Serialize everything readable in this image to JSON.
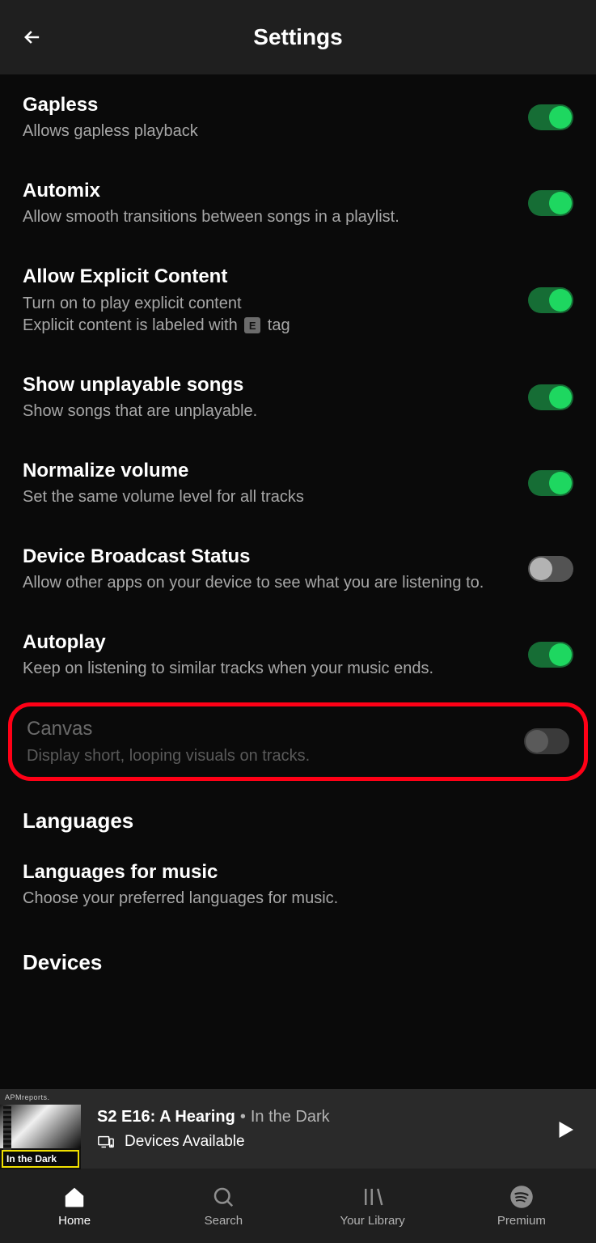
{
  "header": {
    "title": "Settings"
  },
  "settings": [
    {
      "title": "Gapless",
      "desc": "Allows gapless playback",
      "on": true,
      "name": "gapless"
    },
    {
      "title": "Automix",
      "desc": "Allow smooth transitions between songs in a playlist.",
      "on": true,
      "name": "automix"
    },
    {
      "title": "Allow Explicit Content",
      "desc_pre": "Turn on to play explicit content\nExplicit content is labeled with ",
      "desc_tag": "E",
      "desc_post": " tag",
      "on": true,
      "name": "explicit"
    },
    {
      "title": "Show unplayable songs",
      "desc": "Show songs that are unplayable.",
      "on": true,
      "name": "unplayable"
    },
    {
      "title": "Normalize volume",
      "desc": "Set the same volume level for all tracks",
      "on": true,
      "name": "normalize"
    },
    {
      "title": "Device Broadcast Status",
      "desc": "Allow other apps on your device to see what you are listening to.",
      "on": false,
      "name": "broadcast"
    },
    {
      "title": "Autoplay",
      "desc": "Keep on listening to similar tracks when your music ends.",
      "on": true,
      "name": "autoplay"
    },
    {
      "title": "Canvas",
      "desc": "Display short, looping visuals on tracks.",
      "disabled": true,
      "highlighted": true,
      "name": "canvas"
    }
  ],
  "sections": {
    "languages": {
      "heading": "Languages",
      "item_title": "Languages for music",
      "item_desc": "Choose your preferred languages for music."
    },
    "devices": {
      "heading": "Devices"
    }
  },
  "now_playing": {
    "art_top": "APMreports.",
    "art_label": "In the Dark",
    "title": "S2 E16: A Hearing",
    "separator": "•",
    "subtitle": "In the Dark",
    "devices": "Devices Available"
  },
  "tabs": [
    {
      "label": "Home",
      "name": "home",
      "active": true
    },
    {
      "label": "Search",
      "name": "search",
      "active": false
    },
    {
      "label": "Your Library",
      "name": "library",
      "active": false
    },
    {
      "label": "Premium",
      "name": "premium",
      "active": false
    }
  ]
}
